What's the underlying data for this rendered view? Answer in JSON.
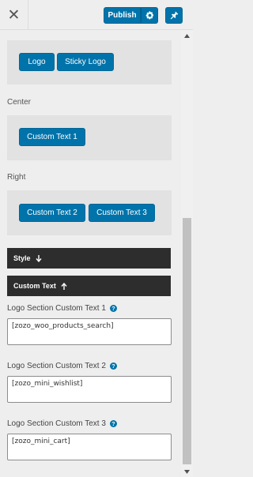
{
  "header": {
    "publish_label": "Publish"
  },
  "zones": {
    "left": {
      "buttons": [
        "Logo",
        "Sticky Logo"
      ]
    },
    "center": {
      "label": "Center",
      "buttons": [
        "Custom Text 1"
      ]
    },
    "right": {
      "label": "Right",
      "buttons": [
        "Custom Text 2",
        "Custom Text 3"
      ]
    }
  },
  "accordions": {
    "style_label": "Style",
    "custom_text_label": "Custom Text"
  },
  "fields": [
    {
      "label": "Logo Section Custom Text 1",
      "value": "[zozo_woo_products_search]"
    },
    {
      "label": "Logo Section Custom Text 2",
      "value": "[zozo_mini_wishlist]"
    },
    {
      "label": "Logo Section Custom Text 3",
      "value": "[zozo_mini_cart]"
    }
  ],
  "icons": {
    "close": "close-icon",
    "gear": "gear-icon",
    "pin": "pin-icon",
    "help": "help-icon",
    "arrow_down": "arrow-down-icon",
    "arrow_up": "arrow-up-icon"
  },
  "colors": {
    "primary": "#0073aa",
    "accordion_bg": "#2d2d2d",
    "zone_bg": "#e2e2e2",
    "panel_bg": "#eeeeee"
  }
}
